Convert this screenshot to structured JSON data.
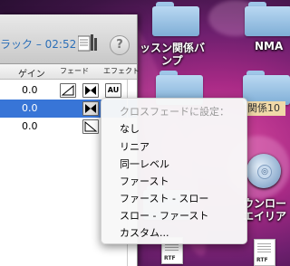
{
  "window": {
    "track_title": "ラック – 02:52",
    "help_label": "?",
    "columns": {
      "gain": "ゲイン",
      "fade": "フェード",
      "effect": "エフェクト"
    },
    "rows": [
      {
        "gain": "0.0",
        "selected": false
      },
      {
        "gain": "0.0",
        "selected": true
      },
      {
        "gain": "0.0",
        "selected": false
      }
    ],
    "effect_badge": "AU"
  },
  "menu": {
    "header": "クロスフェードに設定：",
    "items": [
      "なし",
      "リニア",
      "同一レベル",
      "ファースト",
      "ファースト - スロー",
      "スロー - ファースト",
      "カスタム..."
    ]
  },
  "desktop": {
    "label_1": "ッスン関係バ",
    "label_1b": "ンプ",
    "label_2": "NMA",
    "tag": "関係10",
    "label_3": "ウンロー",
    "label_3b": "エイリア",
    "rtf_1": "RTF",
    "rtf_2": "RTF"
  },
  "colors": {
    "selection": "#3875d7",
    "link_title": "#2b6fb8"
  }
}
